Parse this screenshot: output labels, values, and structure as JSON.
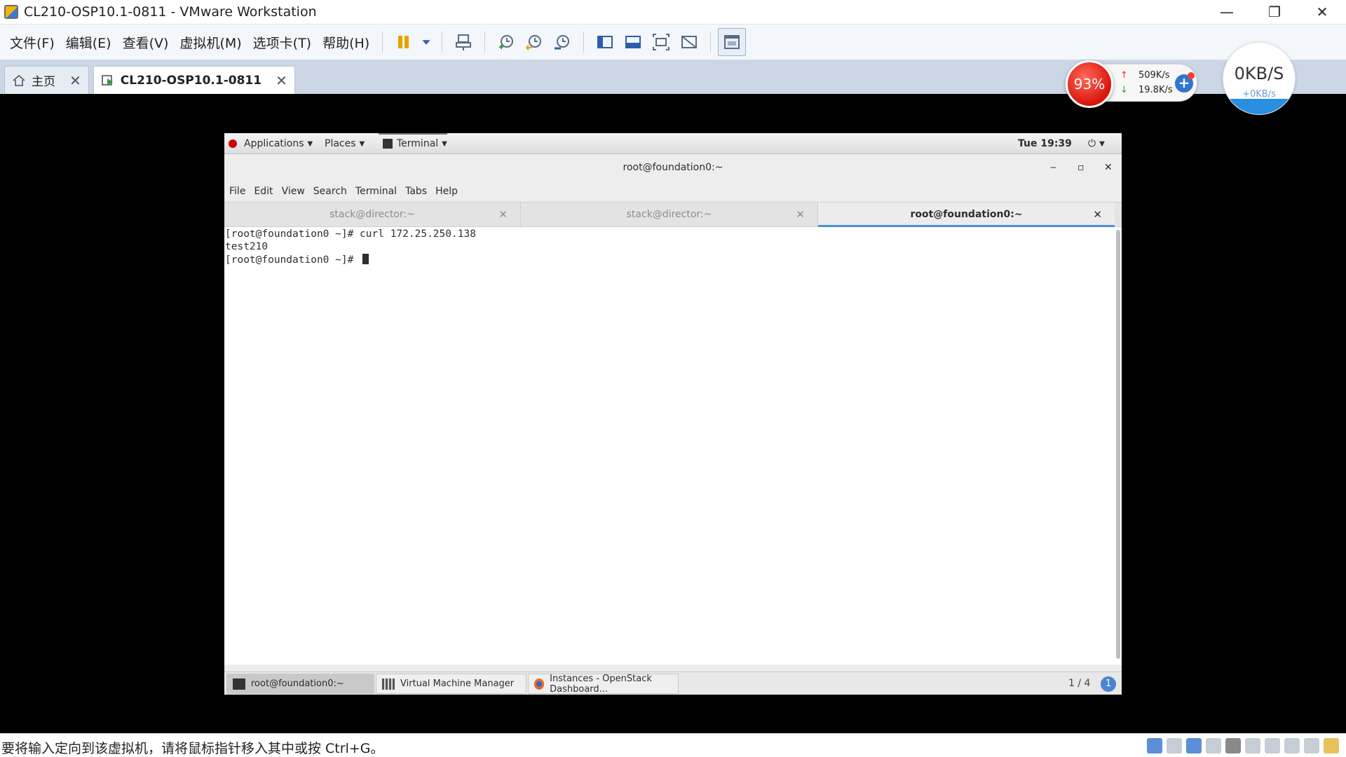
{
  "window": {
    "title": "CL210-OSP10.1-0811 - VMware Workstation",
    "controls": [
      "—",
      "❐",
      "✕"
    ]
  },
  "menubar": [
    "文件(F)",
    "编辑(E)",
    "查看(V)",
    "虚拟机(M)",
    "选项卡(T)",
    "帮助(H)"
  ],
  "toolbar": {
    "icons": [
      "pause-icon",
      "dropdown-icon",
      "send-ctrl-alt-del-icon",
      "snapshot-icon",
      "revert-snapshot-icon",
      "snapshot-manager-icon",
      "show-library-icon",
      "thumbnail-bar-icon",
      "fullscreen-icon",
      "unity-icon",
      "console-view-icon"
    ]
  },
  "tabs": [
    {
      "label": "主页",
      "active": false
    },
    {
      "label": "CL210-OSP10.1-0811",
      "active": true
    }
  ],
  "net_monitor": {
    "percent": "93%",
    "upload": "509K/s",
    "download": "19.8K/s",
    "speed_main": "0KB/S",
    "speed_sub": "+0KB/s"
  },
  "guest": {
    "top_bar": {
      "applications": "Applications",
      "places": "Places",
      "terminal": "Terminal",
      "clock": "Tue 19:39"
    },
    "terminal": {
      "title": "root@foundation0:~",
      "window_controls": [
        "‒",
        "▫",
        "✕"
      ],
      "menu": [
        "File",
        "Edit",
        "View",
        "Search",
        "Terminal",
        "Tabs",
        "Help"
      ],
      "tabs": [
        {
          "label": "stack@director:~",
          "active": false
        },
        {
          "label": "stack@director:~",
          "active": false
        },
        {
          "label": "root@foundation0:~",
          "active": true
        }
      ],
      "lines": [
        "[root@foundation0 ~]# curl 172.25.250.138",
        "test210",
        "[root@foundation0 ~]# "
      ]
    },
    "taskbar": {
      "tasks": [
        {
          "label": "root@foundation0:~",
          "active": true
        },
        {
          "label": "Virtual Machine Manager",
          "active": false
        },
        {
          "label": "Instances - OpenStack Dashboard...",
          "active": false
        }
      ],
      "workspace": "1 / 4",
      "info": "1"
    }
  },
  "statusbar": {
    "text": "要将输入定向到该虚拟机，请将鼠标指针移入其中或按 Ctrl+G。"
  },
  "colors": {
    "menubar_bg": "#f3f6fa",
    "tabbar_bg": "#ccd7e6",
    "vm_background": "#000000",
    "terminal_tab_accent": "#4a90d9",
    "redhat": "#cc0000"
  }
}
